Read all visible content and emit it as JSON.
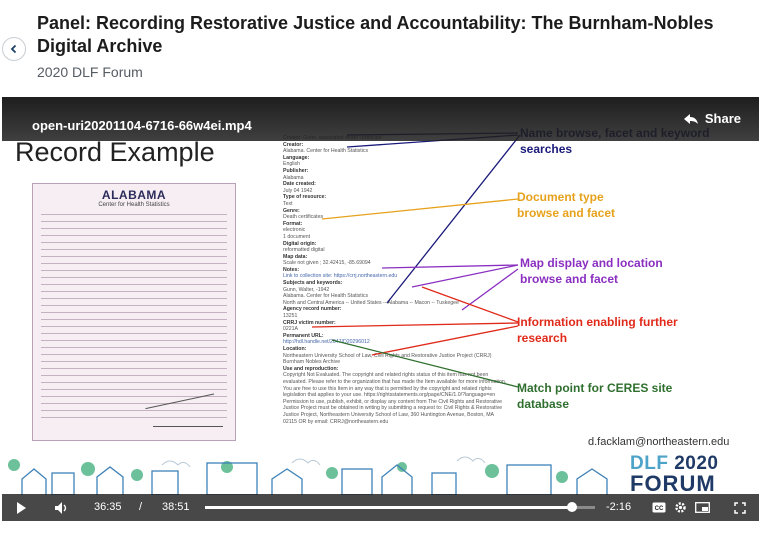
{
  "header": {
    "title": "Panel: Recording Restorative Justice and Accountability: The Burnham-Nobles Digital Archive",
    "subtitle": "2020 DLF Forum"
  },
  "video": {
    "filename": "open-uri20201104-6716-66w4ei.mp4",
    "share_label": "Share",
    "slide_heading": "Record Example",
    "certificate": {
      "title": "ALABAMA",
      "subtitle": "Center for Health Statistics"
    },
    "metadata_lines": [
      {
        "k": "",
        "v": "Creator: Gunn, associated death certificate"
      },
      {
        "k": "Creator:",
        "v": ""
      },
      {
        "k": "",
        "v": "Alabama. Center for Health Statistics"
      },
      {
        "k": "Language:",
        "v": "English"
      },
      {
        "k": "Publisher:",
        "v": "Alabama"
      },
      {
        "k": "Date created:",
        "v": "July 04 1942"
      },
      {
        "k": "Type of resource:",
        "v": "Text"
      },
      {
        "k": "Genre:",
        "v": "Death certificates"
      },
      {
        "k": "Format:",
        "v": "electronic"
      },
      {
        "k": "",
        "v": "1 document"
      },
      {
        "k": "Digital origin:",
        "v": "reformatted digital"
      },
      {
        "k": "Map data:",
        "v": "Scale not given ; 32.42415, -85.69094"
      },
      {
        "k": "Notes:",
        "v": "Link to collection site: https://crrj.northeastern.edu"
      },
      {
        "k": "Subjects and keywords:",
        "v": "Gunn, Walter, -1942"
      },
      {
        "k": "",
        "v": "Alabama. Center for Health Statistics"
      },
      {
        "k": "",
        "v": "North and Central America -- United States -- Alabama -- Macon -- Tuskegee"
      },
      {
        "k": "Agency record number:",
        "v": "13251"
      },
      {
        "k": "CRRJ victim number:",
        "v": "0221A"
      },
      {
        "k": "Permanent URL:",
        "v": "http://hdl.handle.net/2047/D20296012"
      },
      {
        "k": "Location:",
        "v": "Northeastern University School of Law, Civil Rights and Restorative Justice Project (CRRJ)"
      },
      {
        "k": "",
        "v": "Burnham Nobles Archive"
      },
      {
        "k": "Use and reproduction:",
        "v": "Copyright Not Evaluated. The copyright and related rights status of this item has not been evaluated. Please refer to the organization that has made the Item available for more information. You are free to use this Item in any way that is permitted by the copyright and related rights legislation that applies to your use. https://rightsstatements.org/page/CNE/1.0/?language=en"
      },
      {
        "k": "",
        "v": "Permission to use, publish, exhibit, or display any content from The Civil Rights and Restorative Justice Project must be obtained in writing by submitting a request to: Civil Rights & Restorative Justice Project, Northeastern University School of Law, 360 Huntington Avenue, Boston, MA 02115 OR by email: CRRJ@northeastern.edu"
      }
    ],
    "annotations": [
      {
        "text": "Name browse, facet and keyword searches",
        "color": "#1a1a7a"
      },
      {
        "text": "Document type browse and facet",
        "color": "#e6a21c"
      },
      {
        "text": "Map display and location browse and facet",
        "color": "#8a2fc0"
      },
      {
        "text": "Information enabling further research",
        "color": "#e02a1a"
      },
      {
        "text": "Match point for CERES site database",
        "color": "#2f6f2f"
      }
    ],
    "email": "d.facklam@northeastern.edu",
    "logo": {
      "line1a": "DLF",
      "line1b": "2020",
      "line2": "FORUM"
    },
    "controls": {
      "current_time": "36:35",
      "separator": "/",
      "duration": "38:51",
      "remaining": "-2:16",
      "progress_fraction": 0.942
    }
  }
}
